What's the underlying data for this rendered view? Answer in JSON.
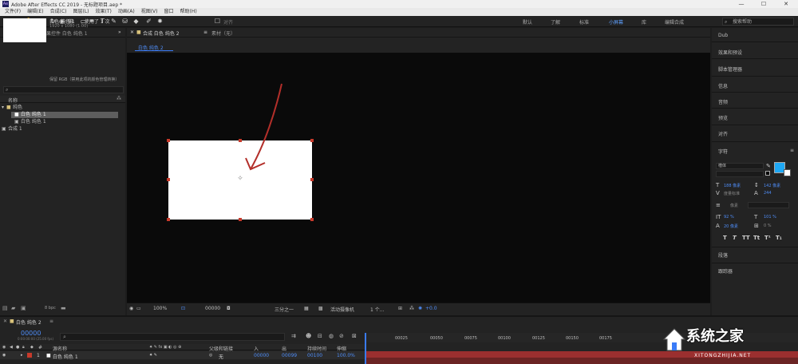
{
  "window": {
    "title": "Adobe After Effects CC 2019 - 无标题项目.aep *",
    "logo": "Ae",
    "controls": [
      "—",
      "☐",
      "✕"
    ]
  },
  "menu": [
    "文件(F)",
    "编辑(E)",
    "合成(C)",
    "图层(L)",
    "效果(T)",
    "动画(A)",
    "视图(V)",
    "窗口",
    "帮助(H)"
  ],
  "toolbar": {
    "snap_label": "对齐",
    "workspaces": [
      "默认",
      "了解",
      "标准",
      "小屏幕",
      "库",
      "编辑合成"
    ],
    "active_workspace": "小屏幕",
    "search_placeholder": "搜索帮助"
  },
  "project": {
    "tab_label": "项目",
    "tab_effects": "效果控件 白色 纯色 1",
    "item_name": "白色 纯色 1",
    "item_used": ", 使用了 1 次",
    "item_dims": "1920 x 1080 (1.00)",
    "color_note": "保留 RGB（禁用此项的颜色管理转换）",
    "col_name": "名称",
    "items": [
      {
        "label": "纯色",
        "type": "folder"
      },
      {
        "label": "白色 纯色 1",
        "type": "solid",
        "selected": true
      },
      {
        "label": "白色 纯色 1",
        "type": "solid",
        "selected": false
      },
      {
        "label": "合成 1",
        "type": "comp"
      }
    ],
    "bpc": "8 bpc"
  },
  "comp": {
    "tab_label": "合成 白色 纯色 2",
    "tab_footage": "素材（无）",
    "subtab": "白色 纯色 2",
    "zoom": "100%",
    "timecode": "00000",
    "resolution": "三分之一",
    "camera": "活动摄像机",
    "views": "1 个...",
    "exposure": "+0.0"
  },
  "right_panel": {
    "top_label": "Dub",
    "items": [
      "效果和预设",
      "脚本管理器",
      "信息",
      "音频",
      "预览",
      "对齐"
    ],
    "char_label": "字符",
    "font_family": "楷体",
    "font_size": "188 像素",
    "leading": "142 像素",
    "kerning": "度量标准",
    "tracking": "244",
    "stroke": "像素",
    "vscale": "92 %",
    "hscale": "101 %",
    "baseline": "20 像素",
    "tsume": "0 %",
    "styles": [
      "T",
      "T",
      "TT",
      "Tt",
      "T¹",
      "T₁"
    ],
    "bottom_items": [
      "段落",
      "跟踪器"
    ],
    "swatch_color": "#1ea8f5"
  },
  "timeline": {
    "tab_label": "白色 纯色 2",
    "time": "00000",
    "fps": "0:00:00:00 (25.00 fps)",
    "header": [
      "源名称",
      "父级和链接",
      "入",
      "出",
      "持续时间",
      "伸缩"
    ],
    "layer": {
      "index": "1",
      "name": "白色 纯色 1",
      "parent": "无",
      "in": "00000",
      "out": "00099",
      "duration": "00100",
      "stretch": "100.0%"
    },
    "ticks": [
      "00025",
      "00050",
      "00075",
      "00100",
      "00125",
      "00150",
      "00175"
    ]
  },
  "watermark": {
    "text": "系统之家",
    "sub": "XITONGZHIJIA.NET"
  }
}
